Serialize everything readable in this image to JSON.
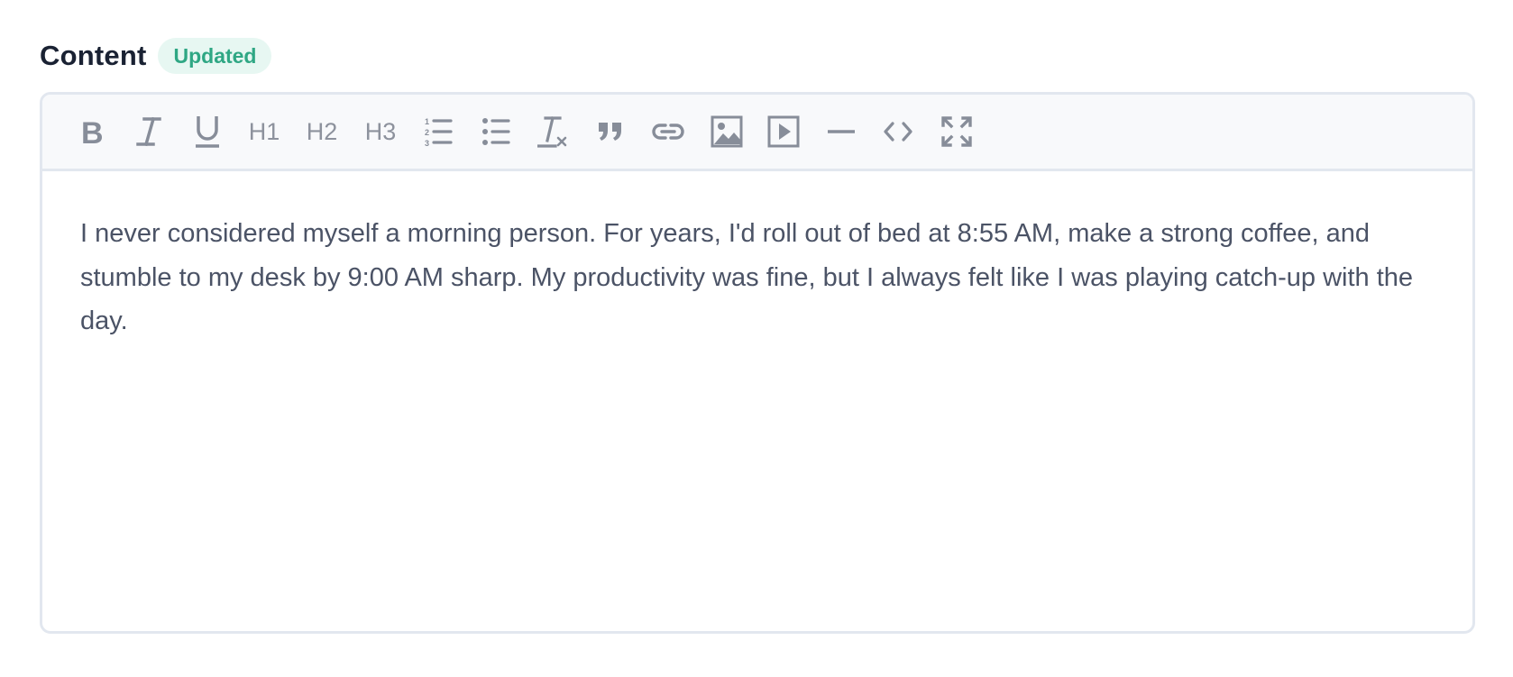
{
  "field": {
    "label": "Content",
    "badge": "Updated"
  },
  "colors": {
    "badge_bg": "#e7f7f2",
    "badge_text": "#2fa784",
    "icon": "#878d99",
    "text": "#4b5366",
    "border": "#e2e7ef"
  },
  "toolbar": {
    "items": [
      {
        "icon": "bold-icon"
      },
      {
        "icon": "italic-icon"
      },
      {
        "icon": "underline-icon"
      },
      {
        "label": "H1"
      },
      {
        "label": "H2"
      },
      {
        "label": "H3"
      },
      {
        "icon": "ordered-list-icon"
      },
      {
        "icon": "bullet-list-icon"
      },
      {
        "icon": "clear-format-icon"
      },
      {
        "icon": "quote-icon"
      },
      {
        "icon": "link-icon"
      },
      {
        "icon": "image-icon"
      },
      {
        "icon": "video-icon"
      },
      {
        "icon": "horizontal-rule-icon"
      },
      {
        "icon": "code-icon"
      },
      {
        "icon": "fullscreen-icon"
      }
    ]
  },
  "editor": {
    "content": "I never considered myself a morning person. For years, I'd roll out of bed at 8:55 AM, make a strong coffee, and stumble to my desk by 9:00 AM sharp. My productivity was fine, but I always felt like I was playing catch-up with the day."
  }
}
